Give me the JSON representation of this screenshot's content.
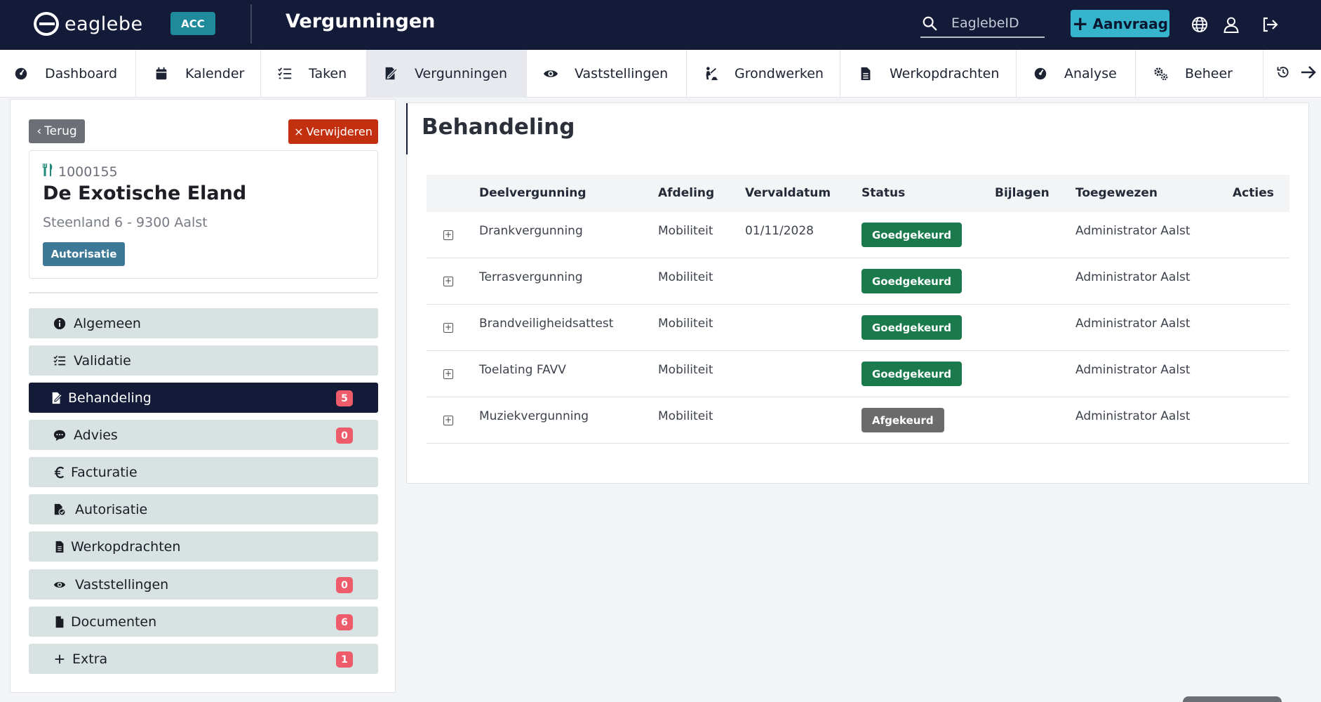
{
  "topbar": {
    "logo_text": "eaglebe",
    "env_badge": "ACC",
    "title": "Vergunningen",
    "search_placeholder": "EaglebeID",
    "new_request_label": "Aanvraag",
    "icons": [
      "globe-icon",
      "user-icon",
      "logout-icon"
    ]
  },
  "nav": {
    "items": [
      {
        "label": "Dashboard",
        "icon": "dashboard-icon"
      },
      {
        "label": "Kalender",
        "icon": "calendar-icon"
      },
      {
        "label": "Taken",
        "icon": "tasks-icon"
      },
      {
        "label": "Vergunningen",
        "icon": "permit-icon",
        "active": true
      },
      {
        "label": "Vaststellingen",
        "icon": "eye-icon"
      },
      {
        "label": "Grondwerken",
        "icon": "digging-icon"
      },
      {
        "label": "Werkopdrachten",
        "icon": "document-icon"
      },
      {
        "label": "Analyse",
        "icon": "analytics-icon"
      },
      {
        "label": "Beheer",
        "icon": "gears-icon"
      }
    ]
  },
  "left": {
    "back_label": "Terug",
    "delete_label": "Verwijderen",
    "dossier_number": "1000155",
    "dossier_name": "De Exotische Eland",
    "address": "Steenland 6 - 9300 Aalst",
    "tag": "Autorisatie",
    "menu": [
      {
        "label": "Algemeen",
        "icon": "info-icon",
        "badge": null
      },
      {
        "label": "Validatie",
        "icon": "checklist-icon",
        "badge": null
      },
      {
        "label": "Behandeling",
        "icon": "file-edit-icon",
        "badge": "5",
        "active": true
      },
      {
        "label": "Advies",
        "icon": "comments-icon",
        "badge": "0"
      },
      {
        "label": "Facturatie",
        "icon": "euro-icon",
        "badge": null
      },
      {
        "label": "Autorisatie",
        "icon": "file-check-icon",
        "badge": null
      },
      {
        "label": "Werkopdrachten",
        "icon": "file-text-icon",
        "badge": null
      },
      {
        "label": "Vaststellingen",
        "icon": "eye-icon",
        "badge": "0"
      },
      {
        "label": "Documenten",
        "icon": "file-icon",
        "badge": "6"
      },
      {
        "label": "Extra",
        "icon": "plus-icon",
        "badge": "1"
      }
    ]
  },
  "main": {
    "title": "Behandeling",
    "table": {
      "columns": [
        "Deelvergunning",
        "Afdeling",
        "Vervaldatum",
        "Status",
        "Bijlagen",
        "Toegewezen",
        "Acties"
      ],
      "rows": [
        {
          "name": "Drankvergunning",
          "department": "Mobiliteit",
          "due": "01/11/2028",
          "status": "Goedgekeurd",
          "status_color": "#1a7a4c",
          "attachments": "",
          "assigned": "Administrator Aalst"
        },
        {
          "name": "Terrasvergunning",
          "department": "Mobiliteit",
          "due": "",
          "status": "Goedgekeurd",
          "status_color": "#1a7a4c",
          "attachments": "",
          "assigned": "Administrator Aalst"
        },
        {
          "name": "Brandveiligheidsattest",
          "department": "Mobiliteit",
          "due": "",
          "status": "Goedgekeurd",
          "status_color": "#1a7a4c",
          "attachments": "",
          "assigned": "Administrator Aalst"
        },
        {
          "name": "Toelating FAVV",
          "department": "Mobiliteit",
          "due": "",
          "status": "Goedgekeurd",
          "status_color": "#1a7a4c",
          "attachments": "",
          "assigned": "Administrator Aalst"
        },
        {
          "name": "Muziekvergunning",
          "department": "Mobiliteit",
          "due": "",
          "status": "Afgekeurd",
          "status_color": "#6c6b6b",
          "attachments": "",
          "assigned": "Administrator Aalst"
        }
      ]
    }
  },
  "colors": {
    "topbar_bg": "#131b38",
    "accent_teal": "#35b4cc",
    "danger": "#c3300f",
    "approved": "#1a7a4c",
    "rejected": "#6c6b6b",
    "badge": "#ee5c6b"
  }
}
